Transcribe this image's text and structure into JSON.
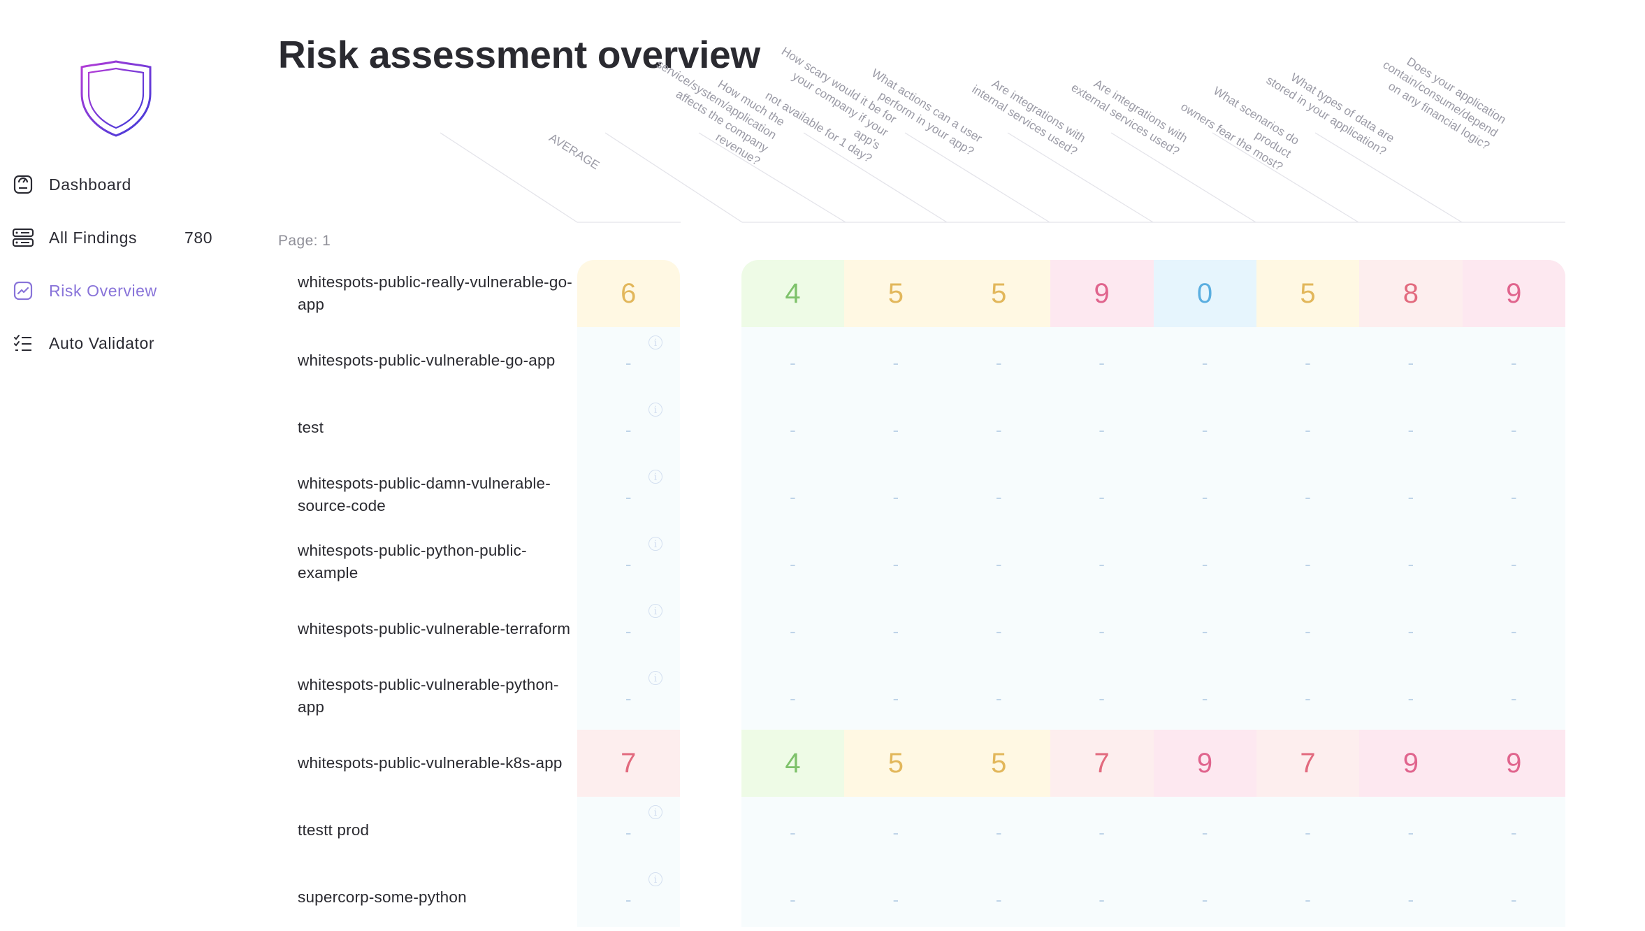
{
  "sidebar": {
    "items": [
      {
        "key": "dashboard",
        "label": "Dashboard",
        "icon": "dashboard-icon",
        "count": ""
      },
      {
        "key": "all-findings",
        "label": "All Findings",
        "icon": "findings-icon",
        "count": "780"
      },
      {
        "key": "risk-overview",
        "label": "Risk Overview",
        "icon": "trend-chart-icon",
        "count": ""
      },
      {
        "key": "auto-validator",
        "label": "Auto Validator",
        "icon": "checklist-icon",
        "count": ""
      }
    ],
    "active": "risk-overview",
    "accent": "#8873d9"
  },
  "page": {
    "title": "Risk assessment overview",
    "pagination": "Page: 1"
  },
  "columns": [
    "AVERAGE",
    "How much the\nservice/system/application\naffects the company\nrevenue?",
    "How scary would it be for\nyour company if your app's\nnot available for 1 day?",
    "What actions can a user\nperform in your app?",
    "Are integrations with\ninternal services used?",
    "Are integrations with\nexternal services used?",
    "What scenarios do product\nowners fear the most?",
    "What types of data are\nstored in your application?",
    "Does your application\ncontain/consume/depend\non any financial logic?"
  ],
  "rows": [
    {
      "name": "whitespots-public-really-vulnerable-go-app",
      "average": "6",
      "scores": [
        "4",
        "5",
        "5",
        "9",
        "0",
        "5",
        "8",
        "9"
      ]
    },
    {
      "name": "whitespots-public-vulnerable-go-app",
      "average": "-",
      "scores": [
        "-",
        "-",
        "-",
        "-",
        "-",
        "-",
        "-",
        "-"
      ]
    },
    {
      "name": "test",
      "average": "-",
      "scores": [
        "-",
        "-",
        "-",
        "-",
        "-",
        "-",
        "-",
        "-"
      ]
    },
    {
      "name": "whitespots-public-damn-vulnerable-source-code",
      "average": "-",
      "scores": [
        "-",
        "-",
        "-",
        "-",
        "-",
        "-",
        "-",
        "-"
      ]
    },
    {
      "name": "whitespots-public-python-public-example",
      "average": "-",
      "scores": [
        "-",
        "-",
        "-",
        "-",
        "-",
        "-",
        "-",
        "-"
      ]
    },
    {
      "name": "whitespots-public-vulnerable-terraform",
      "average": "-",
      "scores": [
        "-",
        "-",
        "-",
        "-",
        "-",
        "-",
        "-",
        "-"
      ]
    },
    {
      "name": "whitespots-public-vulnerable-python-app",
      "average": "-",
      "scores": [
        "-",
        "-",
        "-",
        "-",
        "-",
        "-",
        "-",
        "-"
      ]
    },
    {
      "name": "whitespots-public-vulnerable-k8s-app",
      "average": "7",
      "scores": [
        "4",
        "5",
        "5",
        "7",
        "9",
        "7",
        "9",
        "9"
      ]
    },
    {
      "name": "ttestt prod",
      "average": "-",
      "scores": [
        "-",
        "-",
        "-",
        "-",
        "-",
        "-",
        "-",
        "-"
      ]
    },
    {
      "name": "supercorp-some-python",
      "average": "-",
      "scores": [
        "-",
        "-",
        "-",
        "-",
        "-",
        "-",
        "-",
        "-"
      ]
    }
  ],
  "score_colors": {
    "low": "#7ec26b",
    "medium": "#e2b75b",
    "high": "#e26a7e",
    "critical": "#e0648d",
    "none": "#5aaee0"
  }
}
